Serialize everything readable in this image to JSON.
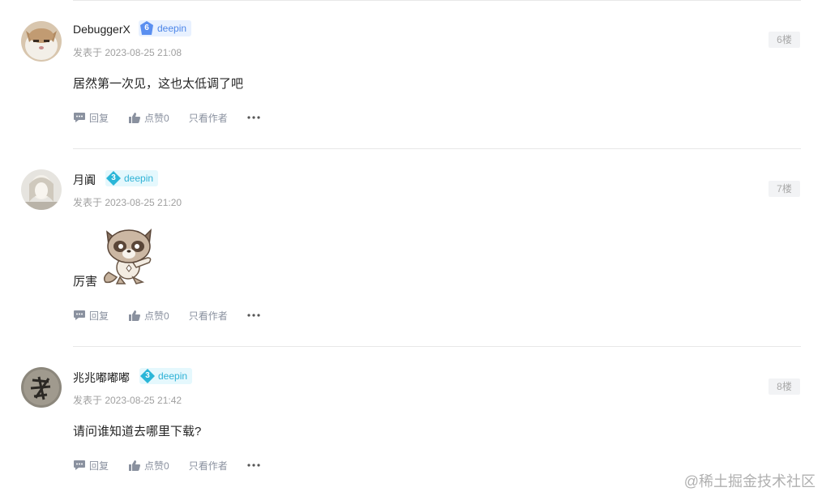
{
  "comments": [
    {
      "username": "DebuggerX",
      "level": "6",
      "badge_text": "deepin",
      "meta": "发表于 2023-08-25 21:08",
      "floor": "6楼",
      "content": "居然第一次见，这也太低调了吧",
      "actions": {
        "reply": "回复",
        "like": "点赞0",
        "author_only": "只看作者"
      }
    },
    {
      "username": "月阗",
      "level": "3",
      "badge_text": "deepin",
      "meta": "发表于 2023-08-25 21:20",
      "floor": "7楼",
      "content": "厉害",
      "actions": {
        "reply": "回复",
        "like": "点赞0",
        "author_only": "只看作者"
      }
    },
    {
      "username": "兆兆嘟嘟嘟",
      "level": "3",
      "badge_text": "deepin",
      "meta": "发表于 2023-08-25 21:42",
      "floor": "8楼",
      "content": "请问谁知道去哪里下载?",
      "actions": {
        "reply": "回复",
        "like": "点赞0",
        "author_only": "只看作者"
      }
    }
  ],
  "watermark": "@稀土掘金技术社区",
  "colors": {
    "level6_badge": "#4d86e8",
    "level3_badge": "#2fb2d6",
    "meta_text": "#a0a0a0",
    "action_text": "#8a919f"
  }
}
